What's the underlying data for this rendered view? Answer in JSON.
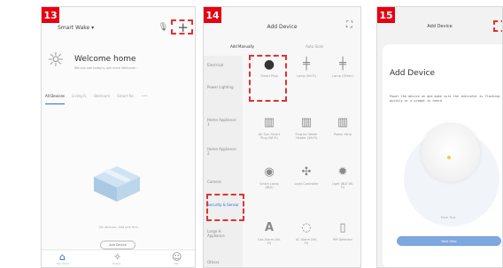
{
  "panels": [
    {
      "step": "13",
      "home_name": "Smart Wake ▾",
      "welcome": "Welcome home",
      "weather_text": "We can see today's, get more Welcome ›",
      "tabs": [
        "All Devices",
        "Living R.",
        "Bedroom",
        "Smart Ro.",
        "•••"
      ],
      "empty_text": "No devices. Add one first.",
      "add_button": "Add Device",
      "nav": [
        "My Home",
        "Scene",
        "Me"
      ]
    },
    {
      "step": "14",
      "title": "Add Device",
      "tabs": [
        "Add Manually",
        "Auto Scan"
      ],
      "categories": [
        "Electrical",
        "Power Lighting",
        "Home Appliance 1",
        "Home Appliance 2",
        "Camera",
        "Security & Sensor",
        "Large H. Appliance",
        "Others"
      ],
      "tiles": [
        "Smart Plug",
        "Lamp (Wi-Fi)",
        "Lamp (Other)",
        "Air Con Smart Plug (Wi-Fi)",
        "Plug for Water Heater (Wi-Fi)",
        "Power Strip",
        "Smart Lamp (BLE)",
        "Light Controller",
        "Light (BLE Wi-Fi)",
        "Gas Alarm (Wi-Fi)",
        "AC Alarm (Wi-Fi)",
        "PIR Detector"
      ]
    },
    {
      "step": "15",
      "title": "Add Device",
      "heading": "Add Device",
      "instruction": "Power the device on and make sure the indicator is flashing quickly or a prompt is heard",
      "hint": "More Tips",
      "next_button": "Next Step"
    }
  ]
}
